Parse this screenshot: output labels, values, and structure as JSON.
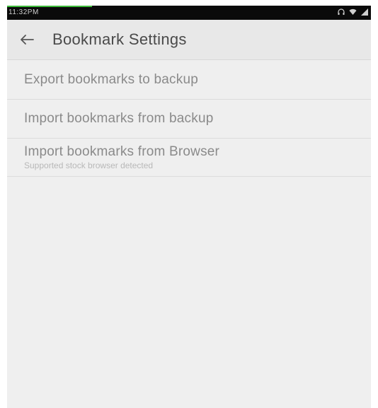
{
  "status_bar": {
    "time": "11:32PM",
    "accent_color": "#3dba3a",
    "icons": [
      "headphones-icon",
      "wifi-icon",
      "signal-icon"
    ]
  },
  "toolbar": {
    "back_icon": "arrow-left-icon",
    "title": "Bookmark Settings"
  },
  "settings": [
    {
      "title": "Export bookmarks to backup",
      "summary": ""
    },
    {
      "title": "Import bookmarks from backup",
      "summary": ""
    },
    {
      "title": "Import bookmarks from Browser",
      "summary": "Supported stock browser detected"
    }
  ],
  "colors": {
    "background": "#efefef",
    "toolbar": "#e8e8e8",
    "title_text": "#4a4a4a",
    "item_text": "#8a8a8a",
    "summary_text": "#b8b8b8"
  }
}
